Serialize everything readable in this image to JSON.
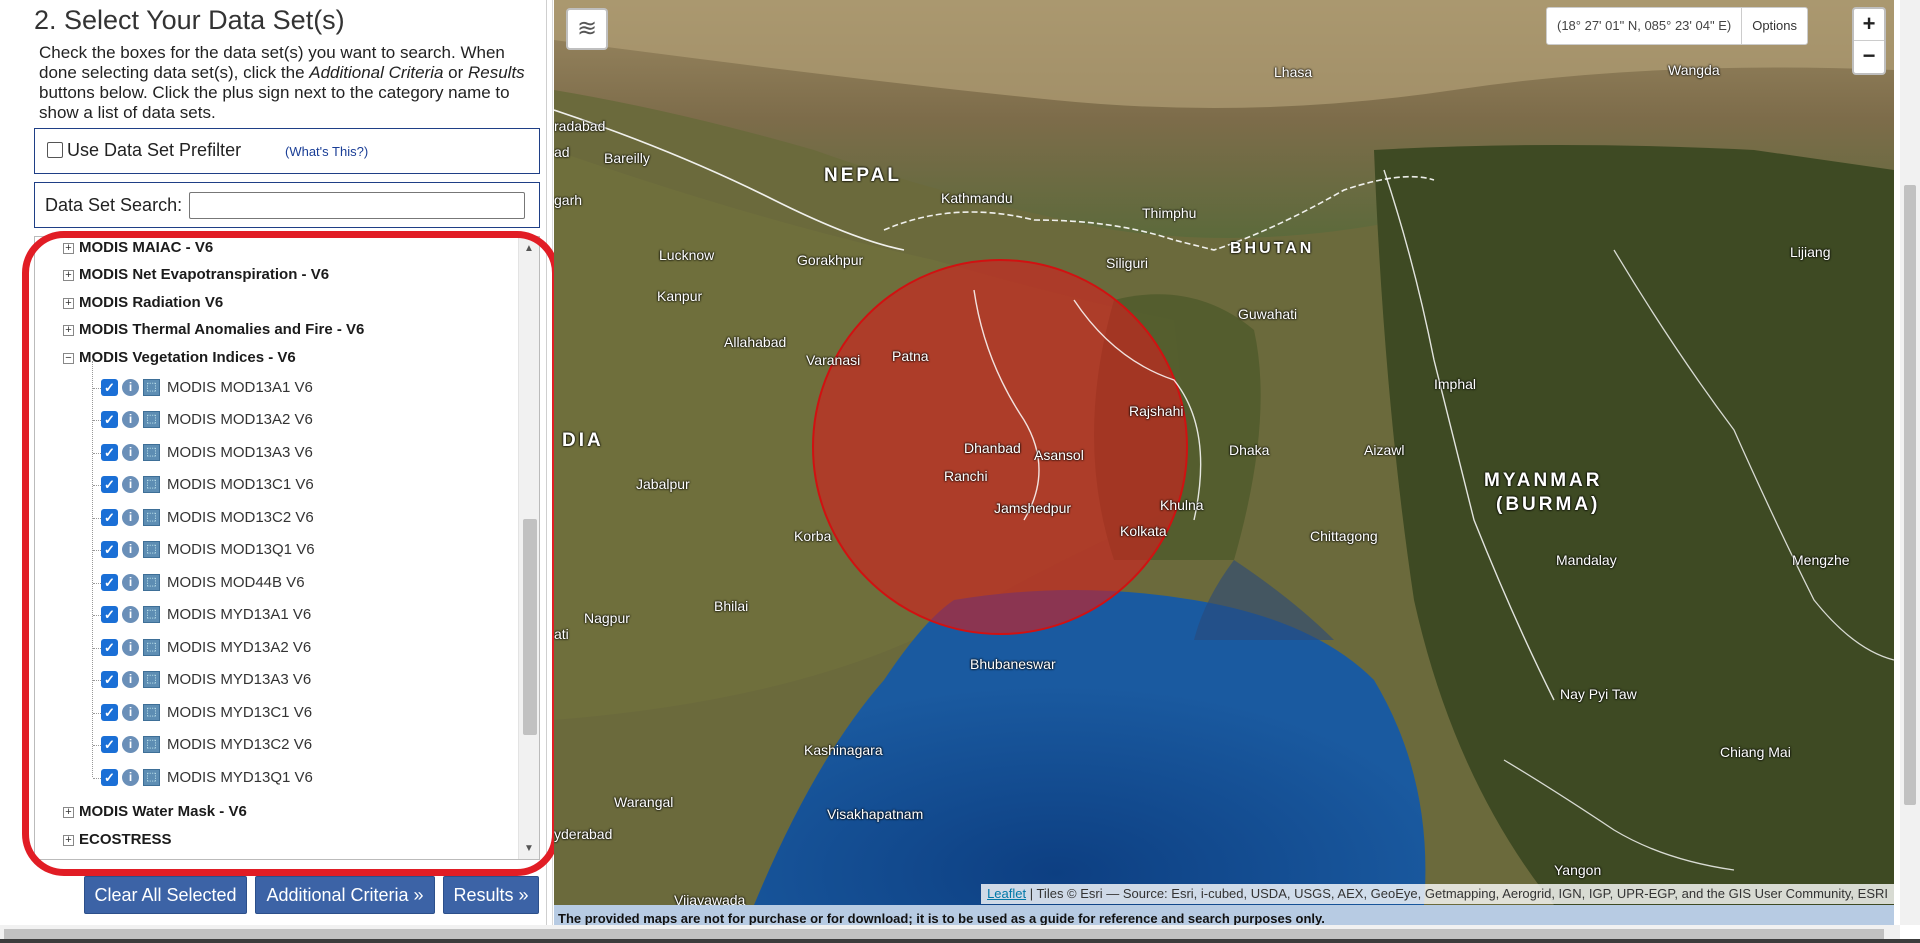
{
  "panel": {
    "heading": "2. Select Your Data Set(s)",
    "intro_1": "Check the boxes for the data set(s) you want to search. When done selecting data set(s), click the ",
    "intro_em1": "Additional Criteria",
    "intro_2": " or ",
    "intro_em2": "Results",
    "intro_3": " buttons below. Click the plus sign next to the category name to show a list of data sets.",
    "prefilter_label": "Use Data Set Prefilter",
    "whats_this": "(What's This?)",
    "search_label": "Data Set Search:",
    "search_value": ""
  },
  "tree": {
    "categories": [
      {
        "label": "MODIS MAIAC - V6",
        "expander": "+"
      },
      {
        "label": "MODIS Net Evapotranspiration - V6",
        "expander": "+"
      },
      {
        "label": "MODIS Radiation V6",
        "expander": "+"
      },
      {
        "label": "MODIS Thermal Anomalies and Fire - V6",
        "expander": "+"
      },
      {
        "label": "MODIS Vegetation Indices - V6",
        "expander": "−"
      }
    ],
    "datasets": [
      {
        "label": "MODIS MOD13A1 V6",
        "checked": true
      },
      {
        "label": "MODIS MOD13A2 V6",
        "checked": true
      },
      {
        "label": "MODIS MOD13A3 V6",
        "checked": true
      },
      {
        "label": "MODIS MOD13C1 V6",
        "checked": true
      },
      {
        "label": "MODIS MOD13C2 V6",
        "checked": true
      },
      {
        "label": "MODIS MOD13Q1 V6",
        "checked": true
      },
      {
        "label": "MODIS MOD44B V6",
        "checked": true
      },
      {
        "label": "MODIS MYD13A1 V6",
        "checked": true
      },
      {
        "label": "MODIS MYD13A2 V6",
        "checked": true
      },
      {
        "label": "MODIS MYD13A3 V6",
        "checked": true
      },
      {
        "label": "MODIS MYD13C1 V6",
        "checked": true
      },
      {
        "label": "MODIS MYD13C2 V6",
        "checked": true
      },
      {
        "label": "MODIS MYD13Q1 V6",
        "checked": true
      }
    ],
    "after_categories": [
      {
        "label": "MODIS Water Mask - V6",
        "expander": "+"
      },
      {
        "label": "ECOSTRESS",
        "expander": "+"
      }
    ],
    "icons": {
      "checkbox": "checkmark-icon",
      "info": "info-icon",
      "map": "footprint-icon"
    }
  },
  "buttons": {
    "clear": "Clear All Selected",
    "criteria": "Additional Criteria »",
    "results": "Results »"
  },
  "map": {
    "coordinates": "(18° 27' 01\" N, 085° 23' 04\" E)",
    "options": "Options",
    "zoom_in": "+",
    "zoom_out": "−",
    "attribution_link": "Leaflet",
    "attribution_text": " | Tiles © Esri — Source: Esri, i-cubed, USDA, USGS, AEX, GeoEye, Getmapping, Aerogrid, IGN, IGP, UPR-EGP, and the GIS User Community, ESRI",
    "note": "The provided maps are not for purchase or for download; it is to be used as a guide for reference and search purposes only.",
    "labels": {
      "nepal": "NEPAL",
      "bhutan": "BHUTAN",
      "india": "DIA",
      "myanmar": "MYANMAR",
      "burma": "(BURMA)",
      "lhasa": "Lhasa",
      "wangda": "Wangda",
      "moradabad": "radabad",
      "bareilly": "Bareilly",
      "kathmandu": "Kathmandu",
      "thimphu": "Thimphu",
      "lucknow": "Lucknow",
      "gorakhpur": "Gorakhpur",
      "siliguri": "Siliguri",
      "lijiang": "Lijiang",
      "kanpur": "Kanpur",
      "guwahati": "Guwahati",
      "allahabad": "Allahabad",
      "varanasi": "Varanasi",
      "patna": "Patna",
      "imphal": "Imphal",
      "rajshahi": "Rajshahi",
      "dhanbad": "Dhanbad",
      "asansol": "Asansol",
      "dhaka": "Dhaka",
      "aizawl": "Aizawl",
      "ranchi": "Ranchi",
      "jabalpur": "Jabalpur",
      "jamshedpur": "Jamshedpur",
      "khulna": "Khulna",
      "kolkata": "Kolkata",
      "chittagong": "Chittagong",
      "korba": "Korba",
      "mandalay": "Mandalay",
      "mengzhe": "Mengzhe",
      "nagpur": "Nagpur",
      "bhilai": "Bhilai",
      "bhubaneswar": "Bhubaneswar",
      "nay_pyi_taw": "Nay Pyi Taw",
      "kashinagara": "Kashinagara",
      "chiang_mai": "Chiang Mai",
      "warangal": "Warangal",
      "visakhapatnam": "Visakhapatnam",
      "hyderabad": "yderabad",
      "yangon": "Yangon",
      "vijayawada": "Vijayawada",
      "garh": "garh",
      "ad": "ad",
      "ati": "ati"
    }
  }
}
